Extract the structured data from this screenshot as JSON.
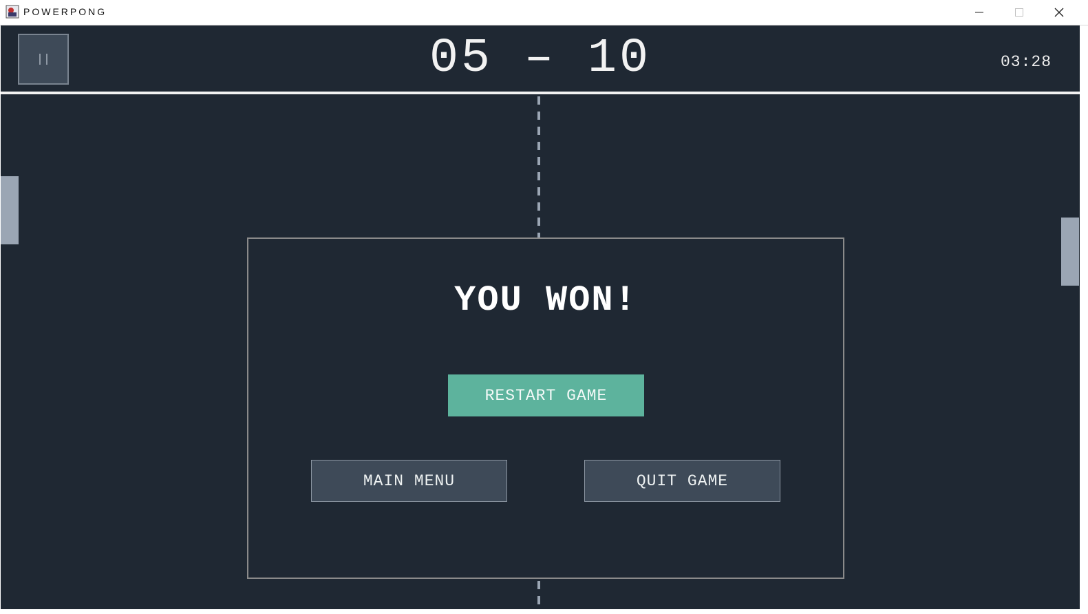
{
  "window": {
    "title": "POWERPONG",
    "controls": {
      "minimize_icon": "minimize-icon",
      "maximize_icon": "maximize-icon",
      "close_icon": "close-icon"
    }
  },
  "hud": {
    "pause_icon": "pause-icon",
    "score": "05 – 10",
    "timer": "03:28"
  },
  "modal": {
    "title": "YOU WON!",
    "restart_label": "RESTART GAME",
    "main_menu_label": "MAIN MENU",
    "quit_label": "QUIT GAME"
  },
  "colors": {
    "background": "#1f2833",
    "paddle": "#9ba6b4",
    "accent": "#5db39d",
    "button": "#3e4a58"
  }
}
